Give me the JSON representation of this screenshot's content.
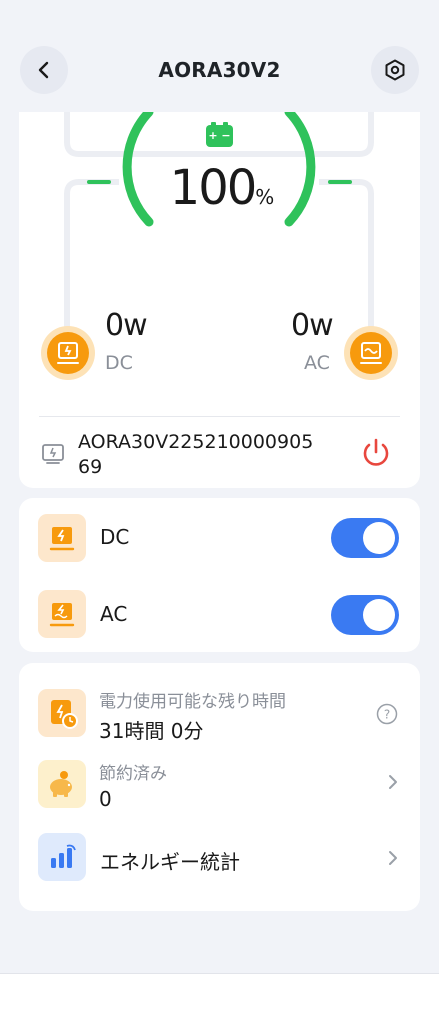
{
  "header": {
    "title": "AORA30V2",
    "back_icon": "chevron-left-icon",
    "settings_icon": "hexagon-gear-icon"
  },
  "status": {
    "battery_percent": "100",
    "percent_sign": "%",
    "battery_level": 1.0,
    "dc": {
      "power": "0w",
      "label": "DC"
    },
    "ac": {
      "power": "0w",
      "label": "AC"
    },
    "device_id": "AORA30V2252100009056 9",
    "device_id_line1": "AORA30V22521000090​5",
    "device_id_line2": "69",
    "power_icon": "power-icon",
    "accent_green": "#2fc25b",
    "accent_orange": "#f79a0d",
    "power_red": "#e8473e"
  },
  "outputs": [
    {
      "label": "DC",
      "on": true
    },
    {
      "label": "AC",
      "on": true
    }
  ],
  "info": {
    "remaining_title": "電力使用可能な残り時間",
    "remaining_value": "31時間 0分",
    "saved_title": "節約済み",
    "saved_value": "0",
    "energy_stats": "エネルギー統計"
  },
  "colors": {
    "toggle_on": "#3a7af2",
    "background": "#f1f3f8"
  }
}
